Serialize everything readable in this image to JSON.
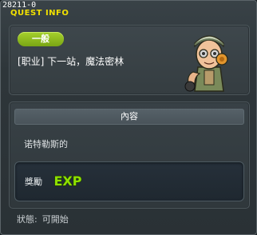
{
  "window": {
    "quest_id": "28211-0",
    "title": "QUEST INFO",
    "close_glyph": "✕"
  },
  "quest": {
    "category": "一般",
    "name": "[职业] 下一站，魔法密林"
  },
  "content": {
    "header": "內容",
    "description": "诺特勒斯的"
  },
  "reward": {
    "label": "獎勵",
    "icon": "exp-icon",
    "icon_text": "EXP"
  },
  "status": {
    "label": "狀態:",
    "value": "可開始"
  },
  "colors": {
    "title": "#f2e100",
    "badge": "#8fbd1f",
    "exp": "#8ee000"
  }
}
